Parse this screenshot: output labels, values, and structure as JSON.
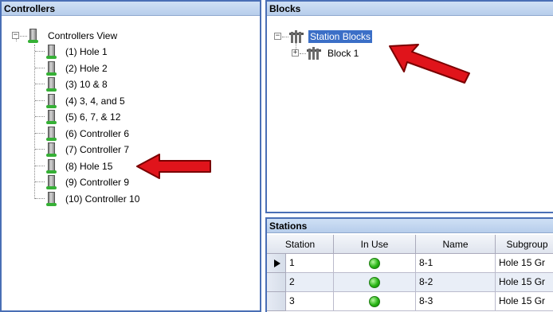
{
  "controllers": {
    "title": "Controllers",
    "root_label": "Controllers View",
    "root_expander": "−",
    "items": [
      {
        "label": "(1)  Hole 1"
      },
      {
        "label": "(2)  Hole 2"
      },
      {
        "label": "(3)  10 & 8"
      },
      {
        "label": "(4)  3, 4, and 5"
      },
      {
        "label": "(5)  6, 7, & 12"
      },
      {
        "label": "(6)  Controller 6"
      },
      {
        "label": "(7)  Controller 7"
      },
      {
        "label": "(8)  Hole 15"
      },
      {
        "label": "(9)  Controller 9"
      },
      {
        "label": "(10)  Controller 10"
      }
    ]
  },
  "blocks": {
    "title": "Blocks",
    "root_label": "Station Blocks",
    "root_expander": "−",
    "child_label": "Block 1",
    "child_expander": "+"
  },
  "stations": {
    "title": "Stations",
    "columns": [
      "Station",
      "In Use",
      "Name",
      "Subgroup"
    ],
    "rows": [
      {
        "station": "1",
        "name": "8-1",
        "subgroup": "Hole 15 Gr"
      },
      {
        "station": "2",
        "name": "8-2",
        "subgroup": "Hole 15 Gr"
      },
      {
        "station": "3",
        "name": "8-3",
        "subgroup": "Hole 15 Gr"
      }
    ]
  },
  "colors": {
    "highlight": "#3b6fc7",
    "arrow_red": "#e0141b",
    "in_use_green": "#28b515"
  },
  "icons": {
    "controller": "controller-icon",
    "block": "sprinkler-block-icon",
    "in_use": "green-status-dot-icon",
    "row_pointer": "row-pointer-icon",
    "annotation": "red-arrow-icon"
  }
}
